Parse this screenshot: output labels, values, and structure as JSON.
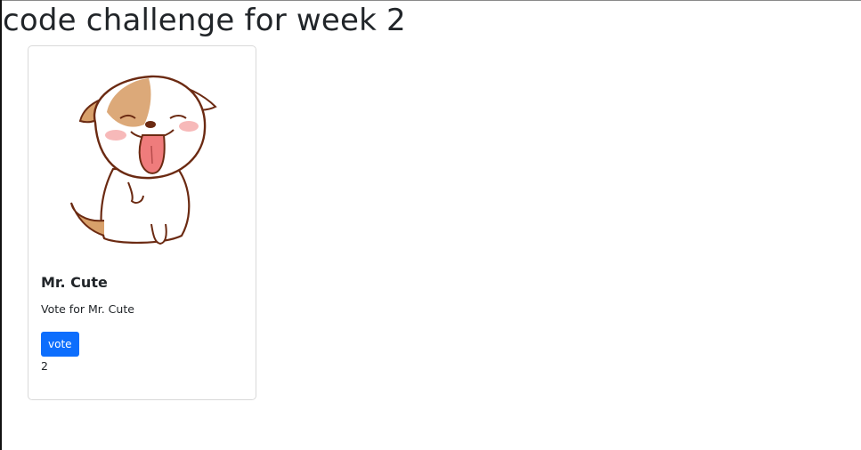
{
  "page": {
    "title": "code challenge for week 2"
  },
  "card": {
    "image_icon": "puppy-illustration",
    "title": "Mr. Cute",
    "text": "Vote for Mr. Cute",
    "button_label": "vote",
    "vote_count": "2"
  },
  "colors": {
    "button": "#0d6efd",
    "text": "#212529",
    "card_border": "#d9d9d9"
  }
}
